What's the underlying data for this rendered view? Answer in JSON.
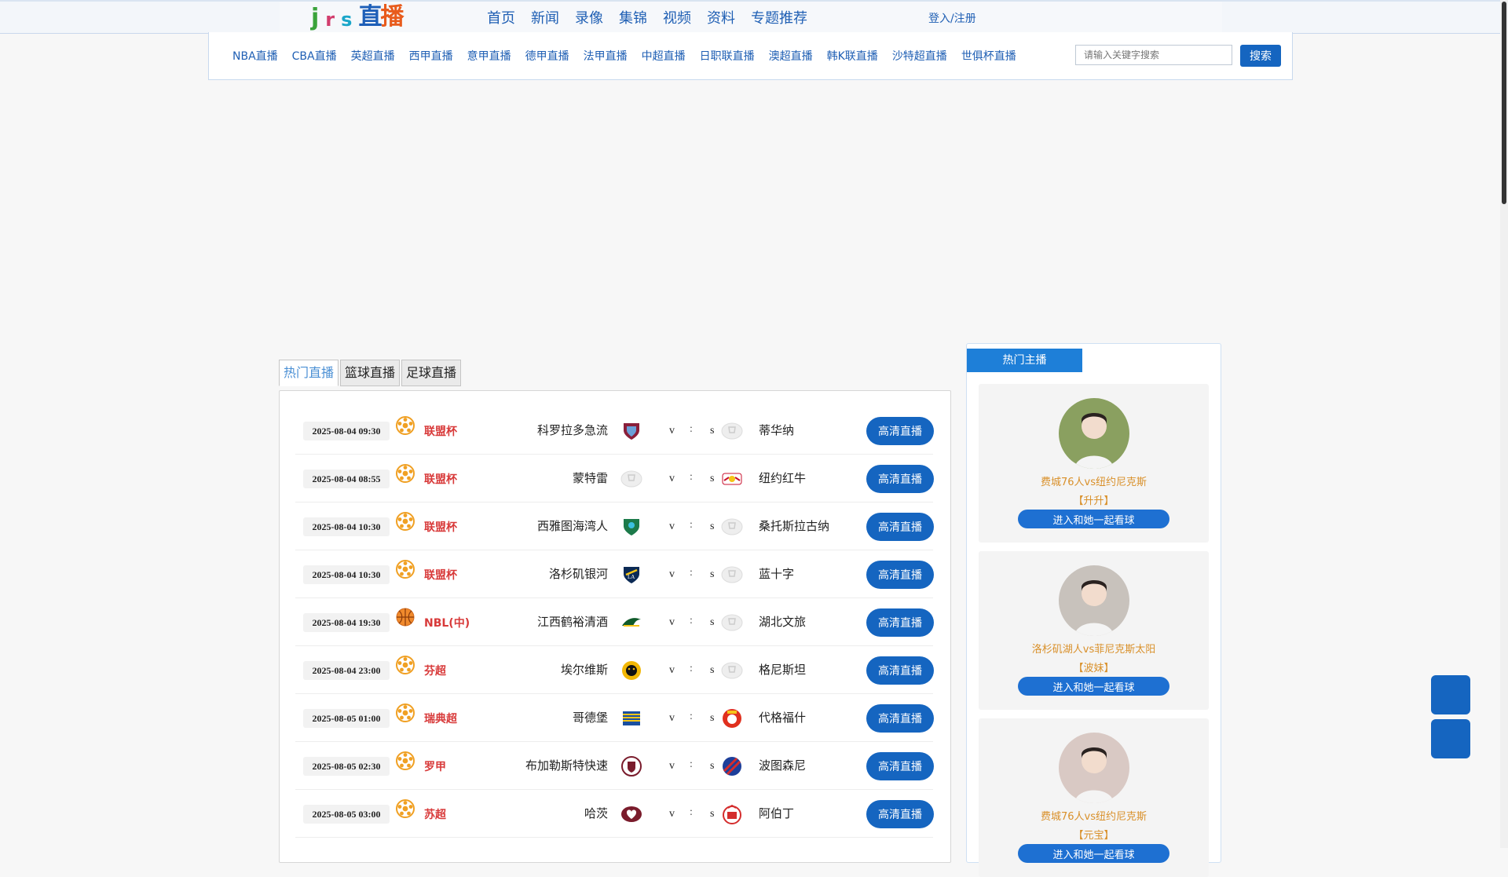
{
  "header": {
    "logo": {
      "j": "j",
      "r": "r",
      "s": "s",
      "zhi": "直",
      "bo": "播"
    },
    "nav": [
      {
        "label": "首页"
      },
      {
        "label": "新闻"
      },
      {
        "label": "录像"
      },
      {
        "label": "集锦"
      },
      {
        "label": "视频"
      },
      {
        "label": "资料"
      },
      {
        "label": "专题推荐"
      }
    ],
    "login_label": "登入/注册"
  },
  "subnav": {
    "links": [
      {
        "label": "NBA直播"
      },
      {
        "label": "CBA直播"
      },
      {
        "label": "英超直播"
      },
      {
        "label": "西甲直播"
      },
      {
        "label": "意甲直播"
      },
      {
        "label": "德甲直播"
      },
      {
        "label": "法甲直播"
      },
      {
        "label": "中超直播"
      },
      {
        "label": "日职联直播"
      },
      {
        "label": "澳超直播"
      },
      {
        "label": "韩K联直播"
      },
      {
        "label": "沙特超直播"
      },
      {
        "label": "世俱杯直播"
      }
    ],
    "search_placeholder": "请输入关键字搜索",
    "search_button": "搜索"
  },
  "tabs": [
    {
      "label": "热门直播",
      "active": true
    },
    {
      "label": "篮球直播",
      "active": false
    },
    {
      "label": "足球直播",
      "active": false
    }
  ],
  "matches": [
    {
      "time": "2025-08-04 09:30",
      "sport": "soccer",
      "league": "联盟杯",
      "home": "科罗拉多急流",
      "home_logo": "shield-red",
      "v": "v",
      "colon": ":",
      "s": "s",
      "away": "蒂华纳",
      "away_logo": "placeholder",
      "button": "高清直播"
    },
    {
      "time": "2025-08-04 08:55",
      "sport": "soccer",
      "league": "联盟杯",
      "home": "蒙特雷",
      "home_logo": "placeholder",
      "v": "v",
      "colon": ":",
      "s": "s",
      "away": "纽约红牛",
      "away_logo": "redbull",
      "button": "高清直播"
    },
    {
      "time": "2025-08-04 10:30",
      "sport": "soccer",
      "league": "联盟杯",
      "home": "西雅图海湾人",
      "home_logo": "shield-green",
      "v": "v",
      "colon": ":",
      "s": "s",
      "away": "桑托斯拉古纳",
      "away_logo": "placeholder",
      "button": "高清直播"
    },
    {
      "time": "2025-08-04 10:30",
      "sport": "soccer",
      "league": "联盟杯",
      "home": "洛杉矶银河",
      "home_logo": "galaxy",
      "v": "v",
      "colon": ":",
      "s": "s",
      "away": "蓝十字",
      "away_logo": "placeholder",
      "button": "高清直播"
    },
    {
      "time": "2025-08-04 19:30",
      "sport": "basketball",
      "league": "NBL(中)",
      "home": "江西鹤裕清酒",
      "home_logo": "bird",
      "v": "v",
      "colon": ":",
      "s": "s",
      "away": "湖北文旅",
      "away_logo": "placeholder",
      "button": "高清直播"
    },
    {
      "time": "2025-08-04 23:00",
      "sport": "soccer",
      "league": "芬超",
      "home": "埃尔维斯",
      "home_logo": "lion-yellow",
      "v": "v",
      "colon": ":",
      "s": "s",
      "away": "格尼斯坦",
      "away_logo": "placeholder",
      "button": "高清直播"
    },
    {
      "time": "2025-08-05 01:00",
      "sport": "soccer",
      "league": "瑞典超",
      "home": "哥德堡",
      "home_logo": "stripes-blue",
      "v": "v",
      "colon": ":",
      "s": "s",
      "away": "代格福什",
      "away_logo": "shield-red-round",
      "button": "高清直播"
    },
    {
      "time": "2025-08-05 02:30",
      "sport": "soccer",
      "league": "罗甲",
      "home": "布加勒斯特快速",
      "home_logo": "crest-maroon",
      "v": "v",
      "colon": ":",
      "s": "s",
      "away": "波图森尼",
      "away_logo": "stripes-red-blue",
      "button": "高清直播"
    },
    {
      "time": "2025-08-05 03:00",
      "sport": "soccer",
      "league": "苏超",
      "home": "哈茨",
      "home_logo": "heart-maroon",
      "v": "v",
      "colon": ":",
      "s": "s",
      "away": "阿伯丁",
      "away_logo": "crest-red",
      "button": "高清直播"
    }
  ],
  "hosts": {
    "title": "热门主播",
    "cards": [
      {
        "match": "费城76人vs纽约尼克斯",
        "name": "【升升】",
        "button": "进入和她一起看球",
        "avatar_bg": "#8aa060"
      },
      {
        "match": "洛杉矶湖人vs菲尼克斯太阳",
        "name": "【波妹】",
        "button": "进入和她一起看球",
        "avatar_bg": "#c8c2bc"
      },
      {
        "match": "费城76人vs纽约尼克斯",
        "name": "【元宝】",
        "button": "进入和她一起看球",
        "avatar_bg": "#d9c9c4"
      }
    ]
  },
  "colors": {
    "accent": "#1565c0",
    "league": "#d83a3a",
    "host_text": "#d9902a"
  }
}
